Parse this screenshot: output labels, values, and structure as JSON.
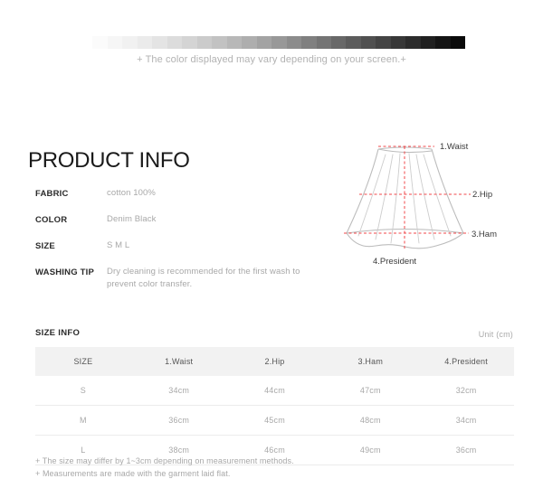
{
  "color_strip": {
    "note": "+ The color displayed may vary depending on your screen.+",
    "swatches": [
      "#ffffff",
      "#fbfbfb",
      "#f6f6f6",
      "#f1f1f1",
      "#ebebeb",
      "#e4e4e4",
      "#dcdcdc",
      "#d4d4d4",
      "#cbcbcb",
      "#c2c2c2",
      "#b8b8b8",
      "#aeaeae",
      "#a3a3a3",
      "#989898",
      "#8c8c8c",
      "#808080",
      "#747474",
      "#686868",
      "#5c5c5c",
      "#505050",
      "#444444",
      "#383838",
      "#2c2c2c",
      "#202020",
      "#141414",
      "#0a0a0a"
    ]
  },
  "product_info": {
    "title": "PRODUCT INFO",
    "specs": [
      {
        "label": "FABRIC",
        "value": "cotton 100%"
      },
      {
        "label": "COLOR",
        "value": "Denim Black"
      },
      {
        "label": "SIZE",
        "value": "S M L"
      },
      {
        "label": "WASHING TIP",
        "value": "Dry cleaning is recommended for the first wash to prevent color transfer."
      }
    ]
  },
  "diagram": {
    "labels": {
      "waist": "1.Waist",
      "hip": "2.Hip",
      "ham": "3.Ham",
      "president": "4.President"
    },
    "outline_color": "#b9b9b9",
    "measure_line_color": "#f0474a"
  },
  "size_info": {
    "title": "SIZE INFO",
    "unit": "Unit (cm)",
    "columns": [
      "SIZE",
      "1.Waist",
      "2.Hip",
      "3.Ham",
      "4.President"
    ],
    "rows": [
      [
        "S",
        "34cm",
        "44cm",
        "47cm",
        "32cm"
      ],
      [
        "M",
        "36cm",
        "45cm",
        "48cm",
        "34cm"
      ],
      [
        "L",
        "38cm",
        "46cm",
        "49cm",
        "36cm"
      ]
    ],
    "footnotes": [
      "+ The size may differ by 1~3cm depending on measurement methods.",
      "+ Measurements are made with the garment laid flat."
    ]
  }
}
